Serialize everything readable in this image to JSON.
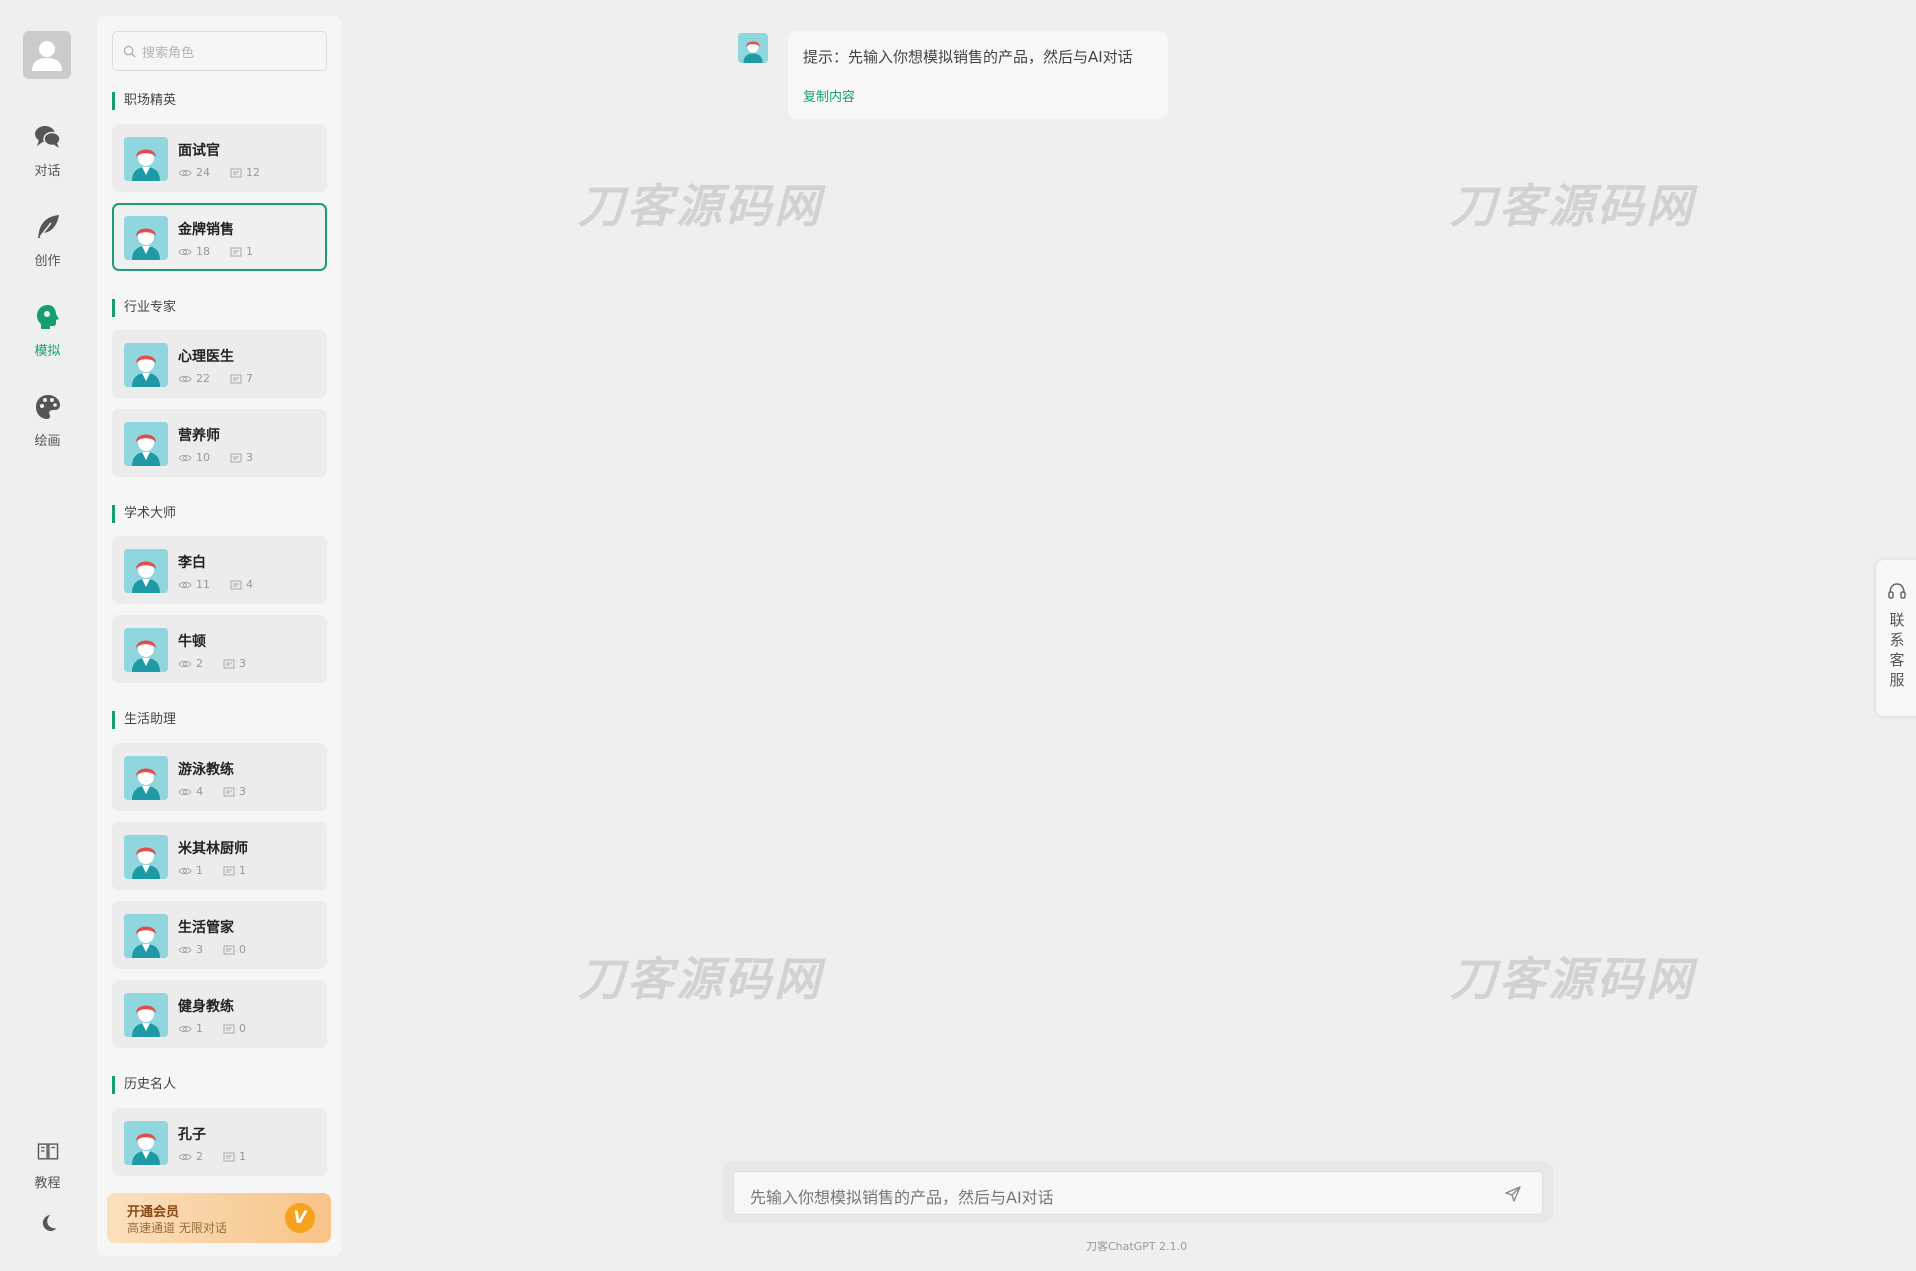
{
  "nav": {
    "items": [
      {
        "label": "对话",
        "icon": "chat-icon",
        "active": false
      },
      {
        "label": "创作",
        "icon": "feather-icon",
        "active": false
      },
      {
        "label": "模拟",
        "icon": "head-icon",
        "active": true
      },
      {
        "label": "绘画",
        "icon": "palette-icon",
        "active": false
      }
    ],
    "tutorial_label": "教程"
  },
  "search": {
    "placeholder": "搜索角色"
  },
  "sections": [
    {
      "title": "职场精英"
    },
    {
      "title": "行业专家"
    },
    {
      "title": "学术大师"
    },
    {
      "title": "生活助理"
    },
    {
      "title": "历史名人"
    }
  ],
  "roles": [
    {
      "name": "面试官",
      "views": "24",
      "chats": "12",
      "active": false
    },
    {
      "name": "金牌销售",
      "views": "18",
      "chats": "1",
      "active": true
    },
    {
      "name": "心理医生",
      "views": "22",
      "chats": "7",
      "active": false
    },
    {
      "name": "营养师",
      "views": "10",
      "chats": "3",
      "active": false
    },
    {
      "name": "李白",
      "views": "11",
      "chats": "4",
      "active": false
    },
    {
      "name": "牛顿",
      "views": "2",
      "chats": "3",
      "active": false
    },
    {
      "name": "游泳教练",
      "views": "4",
      "chats": "3",
      "active": false
    },
    {
      "name": "米其林厨师",
      "views": "1",
      "chats": "1",
      "active": false
    },
    {
      "name": "生活管家",
      "views": "3",
      "chats": "0",
      "active": false
    },
    {
      "name": "健身教练",
      "views": "1",
      "chats": "0",
      "active": false
    },
    {
      "name": "孔子",
      "views": "2",
      "chats": "1",
      "active": false
    }
  ],
  "vip": {
    "title": "开通会员",
    "subtitle": "高速通道 无限对话",
    "badge": "V"
  },
  "chat": {
    "message": "提示：先输入你想模拟销售的产品，然后与AI对话",
    "copy_label": "复制内容"
  },
  "watermark": "刀客源码网",
  "service": {
    "label": "联系客服"
  },
  "input": {
    "placeholder": "先输入你想模拟销售的产品，然后与AI对话"
  },
  "version": "刀客ChatGPT 2.1.0",
  "colors": {
    "accent": "#159e74",
    "vip_badge": "#f7a21c"
  }
}
